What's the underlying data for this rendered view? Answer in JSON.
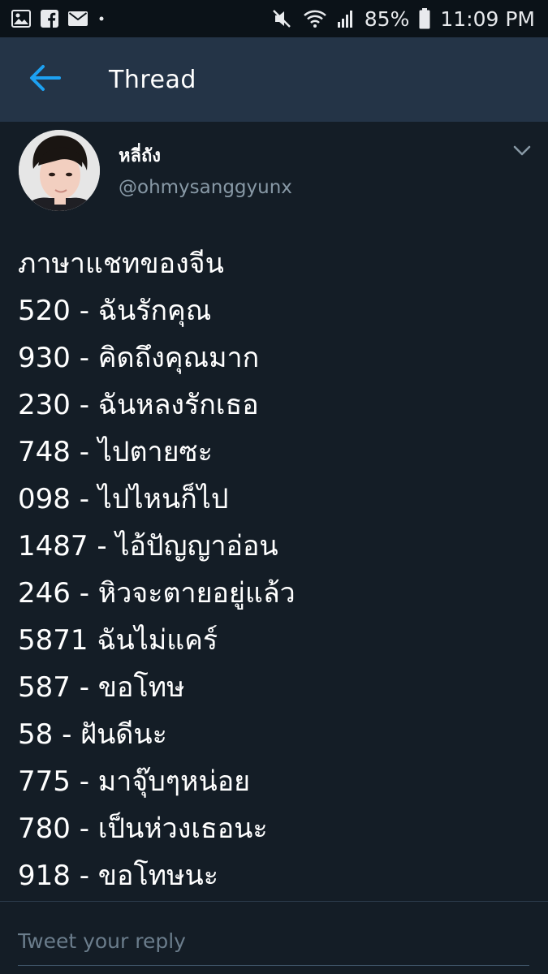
{
  "status_bar": {
    "left_icons": [
      "image-icon",
      "facebook-icon",
      "mail-icon",
      "dot-icon"
    ],
    "right_icons": [
      "mute-icon",
      "wifi-icon",
      "signal-icon",
      "battery-icon"
    ],
    "battery_percent": "85%",
    "time": "11:09 PM"
  },
  "header": {
    "title": "Thread",
    "back_icon": "back-arrow-icon",
    "accent_color": "#1da1f2"
  },
  "tweet": {
    "display_name": "หลี่ถัง",
    "handle": "@ohmysanggyunx",
    "menu_icon": "chevron-down-icon",
    "lines": [
      "ภาษาแชทของจีน",
      "520 - ฉันรักคุณ",
      "930 - คิดถึงคุณมาก",
      "230 - ฉันหลงรักเธอ",
      "748 - ไปตายซะ",
      "098 - ไปไหนก็ไป",
      "1487 - ไอ้ปัญญาอ่อน",
      "246 - หิวจะตายอยู่แล้ว",
      "5871  ฉันไม่แคร์",
      "587 - ขอโทษ",
      "58 - ฝันดีนะ",
      "775 - มาจุ๊บๆหน่อย",
      "780 - เป็นห่วงเธอนะ",
      "918 - ขอโทษนะ"
    ]
  },
  "reply": {
    "placeholder": "Tweet your reply"
  },
  "colors": {
    "background": "#141d26",
    "header": "#243447",
    "secondary_text": "#8899a6"
  }
}
